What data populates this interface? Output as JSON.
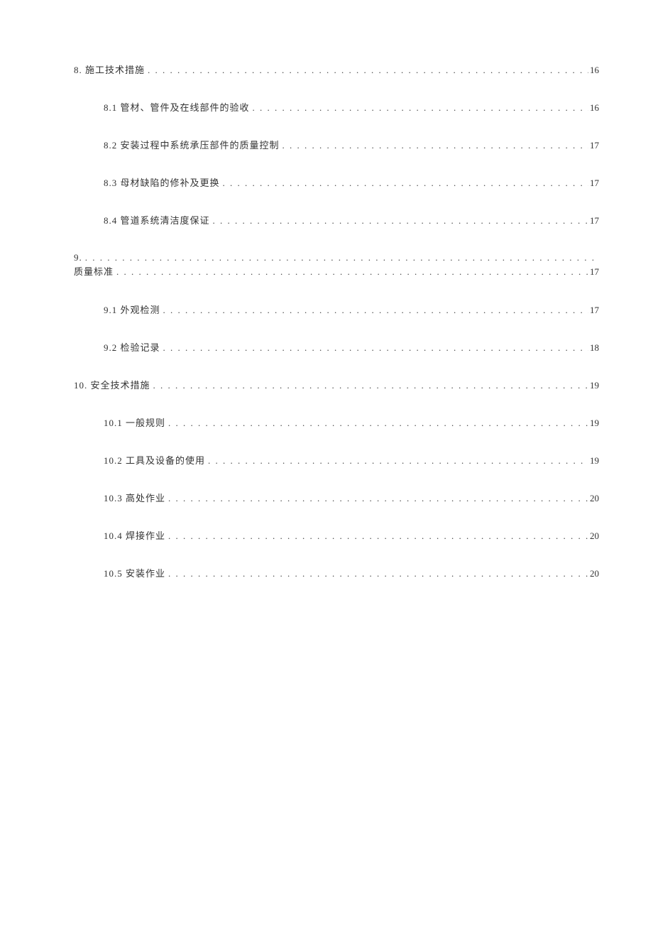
{
  "toc": {
    "entries": [
      {
        "level": 1,
        "label": "8. 施工技术措施",
        "page": "16"
      },
      {
        "level": 2,
        "label": "8.1 管材、管件及在线部件的验收",
        "page": "16"
      },
      {
        "level": 2,
        "label": "8.2 安装过程中系统承压部件的质量控制",
        "page": "17"
      },
      {
        "level": 2,
        "label": "8.3 母材缺陷的修补及更换",
        "page": "17"
      },
      {
        "level": 2,
        "label": "8.4 管道系统清洁度保证",
        "page": "17"
      }
    ],
    "multiline_entry": {
      "first_line_label": "9.",
      "second_line_label": "质量标准",
      "page": "17"
    },
    "entries_after": [
      {
        "level": 2,
        "label": "9.1 外观检测",
        "page": "17"
      },
      {
        "level": 2,
        "label": "9.2 检验记录",
        "page": "18"
      },
      {
        "level": 1,
        "label": "10. 安全技术措施",
        "page": "19"
      },
      {
        "level": 2,
        "label": "10.1 一般规则",
        "page": "19"
      },
      {
        "level": 2,
        "label": "10.2 工具及设备的使用",
        "page": "19"
      },
      {
        "level": 2,
        "label": "10.3 高处作业",
        "page": "20"
      },
      {
        "level": 2,
        "label": "10.4 焊接作业",
        "page": "20"
      },
      {
        "level": 2,
        "label": "10.5 安装作业",
        "page": "20"
      }
    ]
  }
}
